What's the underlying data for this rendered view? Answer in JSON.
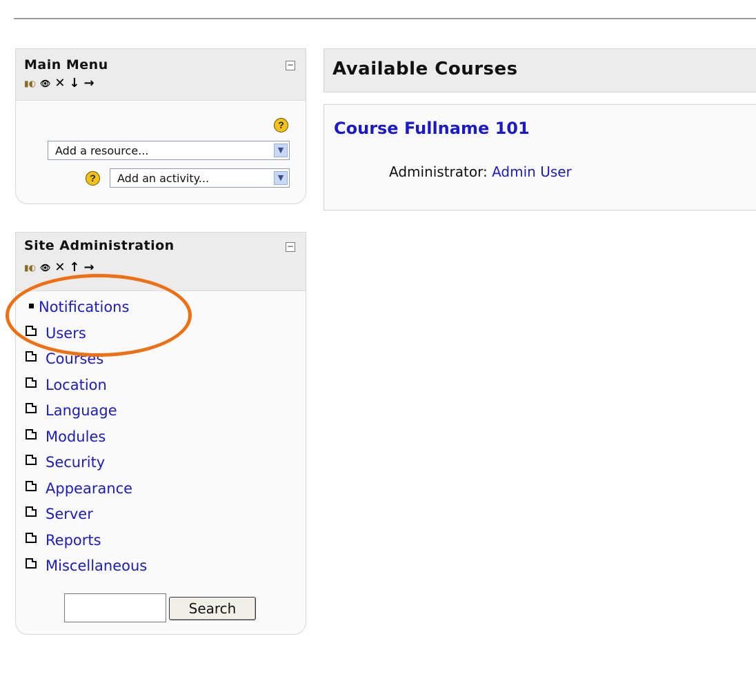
{
  "main_menu": {
    "title": "Main Menu",
    "collapse_icon": "minus-box-icon",
    "add_resource_placeholder": "Add a resource...",
    "add_activity_placeholder": "Add an activity...",
    "help_label": "?"
  },
  "site_admin": {
    "title": "Site Administration",
    "collapse_icon": "minus-box-icon",
    "items": [
      {
        "label": "Notifications",
        "icon": "bullet-icon"
      },
      {
        "label": "Users",
        "icon": "folder-icon"
      },
      {
        "label": "Courses",
        "icon": "folder-icon"
      },
      {
        "label": "Location",
        "icon": "folder-icon"
      },
      {
        "label": "Language",
        "icon": "folder-icon"
      },
      {
        "label": "Modules",
        "icon": "folder-icon"
      },
      {
        "label": "Security",
        "icon": "folder-icon"
      },
      {
        "label": "Appearance",
        "icon": "folder-icon"
      },
      {
        "label": "Server",
        "icon": "folder-icon"
      },
      {
        "label": "Reports",
        "icon": "folder-icon"
      },
      {
        "label": "Miscellaneous",
        "icon": "folder-icon"
      }
    ],
    "search_value": "",
    "search_button": "Search"
  },
  "courses": {
    "heading": "Available Courses",
    "course_name": "Course Fullname 101",
    "teacher_role": "Administrator:",
    "teacher_name": "Admin User"
  },
  "colors": {
    "link": "#1a1acc",
    "highlight": "#f06f12",
    "header_bg": "#ececec"
  }
}
